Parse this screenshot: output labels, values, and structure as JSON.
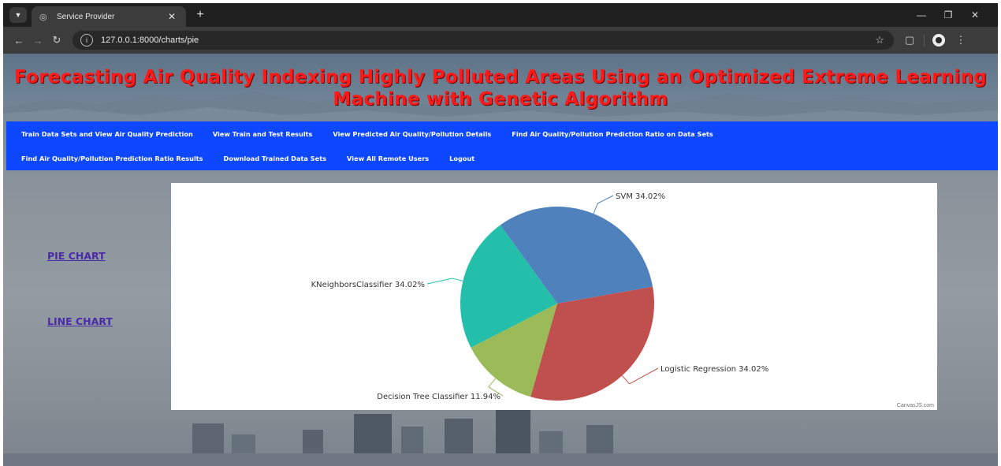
{
  "browser": {
    "tab_title": "Service Provider",
    "new_tab_label": "+",
    "url": "127.0.0.1:8000/charts/pie",
    "icons": [
      "tab-search-icon",
      "globe-icon",
      "close-icon",
      "back-icon",
      "forward-icon",
      "reload-icon",
      "info-icon",
      "star-icon",
      "extensions-icon",
      "profile-icon",
      "menu-icon",
      "minimize-icon",
      "restore-icon",
      "close-window-icon"
    ]
  },
  "page": {
    "title": "Forecasting Air Quality Indexing Highly Polluted Areas Using an Optimized Extreme Learning Machine with Genetic Algorithm",
    "colors": {
      "title": "#ff1a1a",
      "nav_background": "#0d47ff",
      "side_link": "#4a2aa8"
    }
  },
  "nav": {
    "row1": [
      "Train Data Sets and View Air Quality Prediction",
      "View Train and Test Results",
      "View Predicted Air Quality/Pollution Details",
      "Find Air Quality/Pollution Prediction Ratio on Data Sets"
    ],
    "row2": [
      "Find Air Quality/Pollution Prediction Ratio Results",
      "Download Trained Data Sets",
      "View All Remote Users",
      "Logout"
    ]
  },
  "sidebar": {
    "pie_chart": "PIE CHART",
    "line_chart": "LINE CHART"
  },
  "chart_data": {
    "type": "pie",
    "categories": [
      "SVM",
      "Logistic Regression",
      "Decision Tree Classifier",
      "KNeighborsClassifier"
    ],
    "values": [
      34.02,
      34.02,
      11.94,
      34.02
    ],
    "value_suffix": "%",
    "colors": [
      "#4f81bc",
      "#c0504e",
      "#9bbb58",
      "#23bfaa"
    ],
    "credit": "CanvasJS.com"
  }
}
